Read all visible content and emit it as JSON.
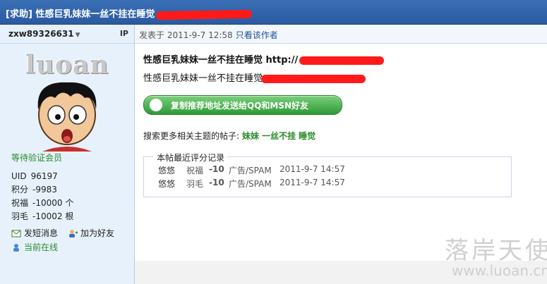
{
  "header": {
    "title": "[求助] 性感巨乳妹妹一丝不挂在睡觉"
  },
  "sidebar": {
    "username": "zxw89326631",
    "ip_label": "IP",
    "logo_text": "luoan",
    "rank": "等待验证会员",
    "stats": [
      {
        "key": "UID",
        "value": "96197"
      },
      {
        "key": "积分",
        "value": "-9983"
      },
      {
        "key": "祝福",
        "value": "-10000 个"
      },
      {
        "key": "羽毛",
        "value": "-10002 根"
      }
    ],
    "actions": {
      "message": "发短消息",
      "add_friend": "加为好友",
      "online": "当前在线"
    }
  },
  "post": {
    "posted_at": "发表于 2011-9-7 12:58",
    "author_only": "只看该作者",
    "title": "性感巨乳妹妹一丝不挂在睡觉  http://",
    "body": "性感巨乳妹妹一丝不挂在睡觉",
    "copy_button": "复制推荐地址发送给QQ和MSN好友",
    "related_label": "搜索更多相关主题的帖子:",
    "related_tags": [
      "妹妹",
      "一丝不挂",
      "睡觉"
    ]
  },
  "ratings": {
    "legend": "本帖最近评分记录",
    "rows": [
      {
        "user": "悠悠",
        "type": "祝福",
        "value": "-10",
        "reason": "广告/SPAM",
        "date": "2011-9-7 14:57"
      },
      {
        "user": "悠悠",
        "type": "羽毛",
        "value": "-10",
        "reason": "广告/SPAM",
        "date": "2011-9-7 14:57"
      }
    ]
  },
  "watermark": {
    "text": "落岸天使",
    "url": "www.luoan.cn"
  },
  "colors": {
    "header_bg": "#2a5aa0",
    "sidebar_bg": "#e7f1fb",
    "accent_green": "#2a8a2a",
    "redaction": "#ff1a1a"
  }
}
